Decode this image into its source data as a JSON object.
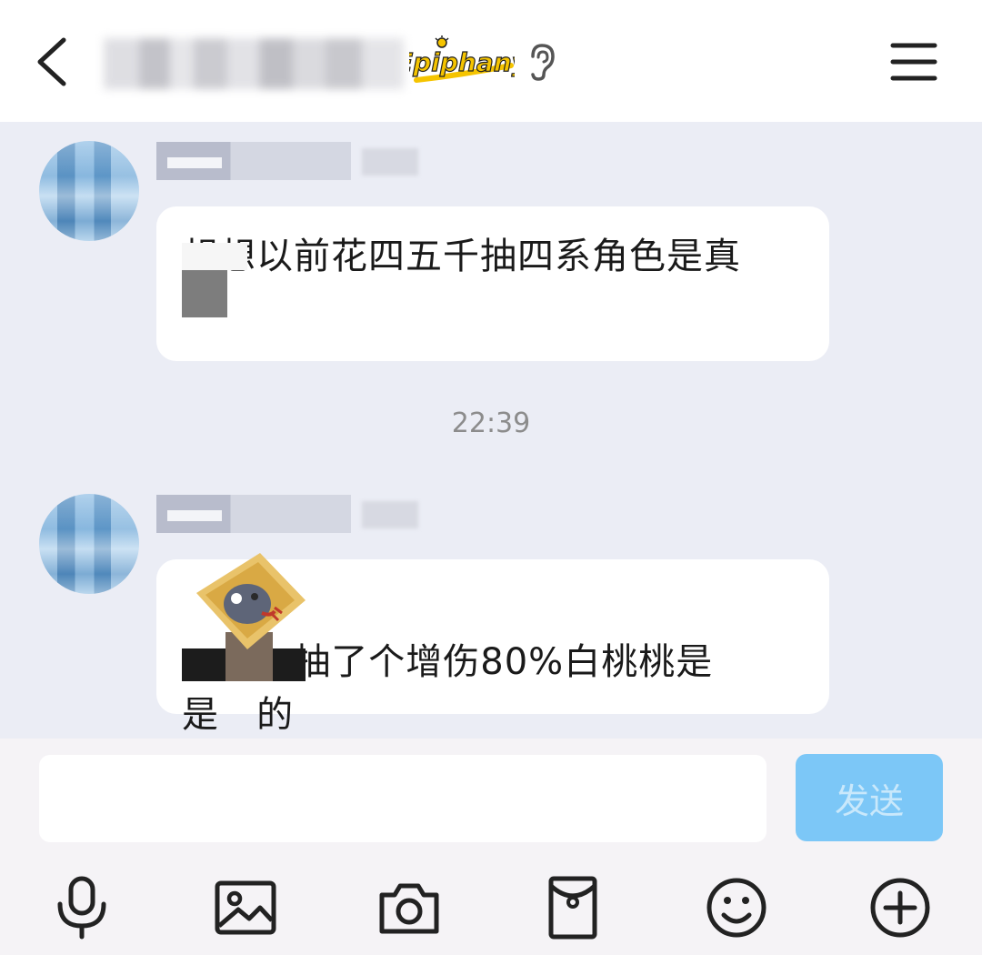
{
  "header": {
    "badge_text": "Epiphany"
  },
  "messages": [
    {
      "text": "想想以前花四五千抽四系角色是真"
    },
    {
      "text": "这  抽了个增伤80%白桃桃是\n是   的"
    }
  ],
  "timestamp": "22:39",
  "composer": {
    "input_value": "",
    "send_label": "发送"
  },
  "toolbar": {
    "icons": [
      "microphone-icon",
      "image-icon",
      "camera-icon",
      "red-packet-icon",
      "emoji-icon",
      "plus-icon"
    ]
  },
  "colors": {
    "chat_background": "#ebedf5",
    "send_button": "#7cc7f7",
    "badge_yellow": "#f5c400"
  }
}
